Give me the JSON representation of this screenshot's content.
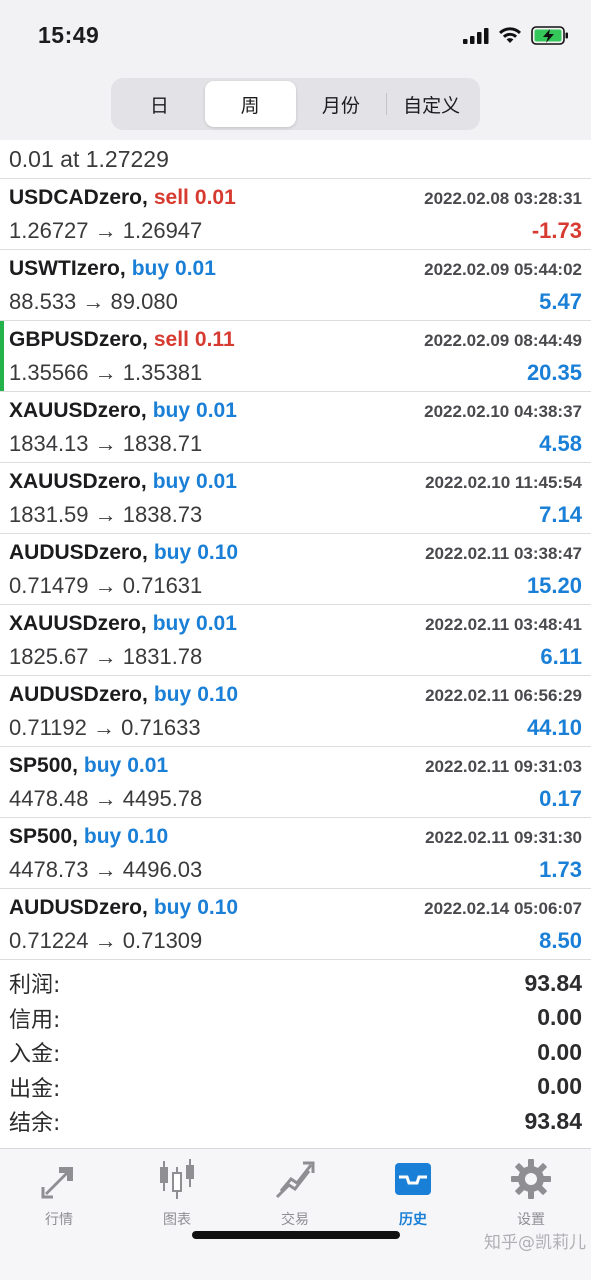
{
  "status_bar": {
    "time": "15:49"
  },
  "segments": [
    {
      "label": "日",
      "active": false
    },
    {
      "label": "周",
      "active": true
    },
    {
      "label": "月份",
      "active": false
    },
    {
      "label": "自定义",
      "active": false
    }
  ],
  "partial_row_text": "0.01 at 1.27229",
  "trades": [
    {
      "symbol": "USDCADzero",
      "type": "sell",
      "volume": "0.01",
      "time": "2022.02.08 03:28:31",
      "prices": "1.26727 → 1.26947",
      "profit": "-1.73"
    },
    {
      "symbol": "USWTIzero",
      "type": "buy",
      "volume": "0.01",
      "time": "2022.02.09 05:44:02",
      "prices": "88.533 → 89.080",
      "profit": "5.47"
    },
    {
      "symbol": "GBPUSDzero",
      "type": "sell",
      "volume": "0.11",
      "time": "2022.02.09 08:44:49",
      "prices": "1.35566 → 1.35381",
      "profit": "20.35"
    },
    {
      "symbol": "XAUUSDzero",
      "type": "buy",
      "volume": "0.01",
      "time": "2022.02.10 04:38:37",
      "prices": "1834.13 → 1838.71",
      "profit": "4.58"
    },
    {
      "symbol": "XAUUSDzero",
      "type": "buy",
      "volume": "0.01",
      "time": "2022.02.10 11:45:54",
      "prices": "1831.59 → 1838.73",
      "profit": "7.14"
    },
    {
      "symbol": "AUDUSDzero",
      "type": "buy",
      "volume": "0.10",
      "time": "2022.02.11 03:38:47",
      "prices": "0.71479 → 0.71631",
      "profit": "15.20"
    },
    {
      "symbol": "XAUUSDzero",
      "type": "buy",
      "volume": "0.01",
      "time": "2022.02.11 03:48:41",
      "prices": "1825.67 → 1831.78",
      "profit": "6.11"
    },
    {
      "symbol": "AUDUSDzero",
      "type": "buy",
      "volume": "0.10",
      "time": "2022.02.11 06:56:29",
      "prices": "0.71192 → 0.71633",
      "profit": "44.10"
    },
    {
      "symbol": "SP500",
      "type": "buy",
      "volume": "0.01",
      "time": "2022.02.11 09:31:03",
      "prices": "4478.48 → 4495.78",
      "profit": "0.17"
    },
    {
      "symbol": "SP500",
      "type": "buy",
      "volume": "0.10",
      "time": "2022.02.11 09:31:30",
      "prices": "4478.73 → 4496.03",
      "profit": "1.73"
    },
    {
      "symbol": "AUDUSDzero",
      "type": "buy",
      "volume": "0.10",
      "time": "2022.02.14 05:06:07",
      "prices": "0.71224 → 0.71309",
      "profit": "8.50"
    }
  ],
  "summary": [
    {
      "label": "利润:",
      "value": "93.84"
    },
    {
      "label": "信用:",
      "value": "0.00"
    },
    {
      "label": "入金:",
      "value": "0.00"
    },
    {
      "label": "出金:",
      "value": "0.00"
    },
    {
      "label": "结余:",
      "value": "93.84"
    }
  ],
  "tabs": [
    {
      "label": "行情",
      "icon": "quotes-arrows-icon",
      "active": false
    },
    {
      "label": "图表",
      "icon": "candlestick-chart-icon",
      "active": false
    },
    {
      "label": "交易",
      "icon": "trade-chart-icon",
      "active": false
    },
    {
      "label": "历史",
      "icon": "history-inbox-icon",
      "active": true
    },
    {
      "label": "设置",
      "icon": "gear-icon",
      "active": false
    }
  ],
  "colors": {
    "buy": "#1a7fd6",
    "sell": "#d73a30",
    "accent": "#1a7fd6",
    "highlight_bar": "#24b34a"
  },
  "watermark": "知乎@凯莉儿"
}
